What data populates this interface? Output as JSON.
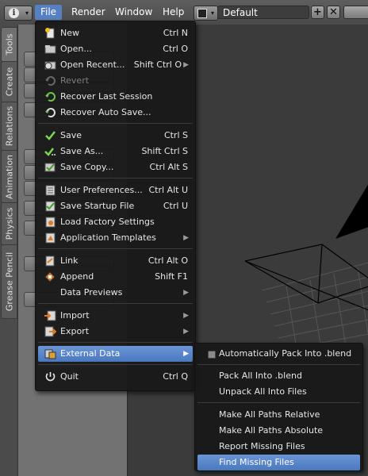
{
  "header": {
    "menus": [
      "File",
      "Render",
      "Window",
      "Help"
    ],
    "layout_name": "Default",
    "add_symbol": "+",
    "remove_symbol": "✕"
  },
  "toolshelf": {
    "tabs": [
      "Tools",
      "Create",
      "Relations",
      "Animation",
      "Physics",
      "Grease Pencil"
    ]
  },
  "file_menu": {
    "items": [
      {
        "label": "New",
        "shortcut": "Ctrl N",
        "icon": "new-file-icon"
      },
      {
        "label": "Open...",
        "shortcut": "Ctrl O",
        "icon": "folder-icon"
      },
      {
        "label": "Open Recent...",
        "shortcut": "Shift Ctrl O",
        "icon": "open-recent-icon",
        "submenu": true
      },
      {
        "label": "Revert",
        "shortcut": "",
        "icon": "revert-icon",
        "disabled": true
      },
      {
        "label": "Recover Last Session",
        "shortcut": "",
        "icon": "recover-icon"
      },
      {
        "label": "Recover Auto Save...",
        "shortcut": "",
        "icon": "recover-autosave-icon"
      },
      {
        "label": "Save",
        "shortcut": "Ctrl S",
        "icon": "checkmark-icon"
      },
      {
        "label": "Save As...",
        "shortcut": "Shift Ctrl S",
        "icon": "save-as-icon"
      },
      {
        "label": "Save Copy...",
        "shortcut": "Ctrl Alt S",
        "icon": "save-copy-icon"
      },
      {
        "label": "User Preferences...",
        "shortcut": "Ctrl Alt U",
        "icon": "preferences-icon"
      },
      {
        "label": "Save Startup File",
        "shortcut": "Ctrl U",
        "icon": "save-startup-icon"
      },
      {
        "label": "Load Factory Settings",
        "shortcut": "",
        "icon": "factory-settings-icon"
      },
      {
        "label": "Application Templates",
        "shortcut": "",
        "icon": "templates-icon",
        "submenu": true
      },
      {
        "label": "Link",
        "shortcut": "Ctrl Alt O",
        "icon": "link-icon"
      },
      {
        "label": "Append",
        "shortcut": "Shift F1",
        "icon": "append-icon"
      },
      {
        "label": "Data Previews",
        "shortcut": "",
        "icon": "",
        "submenu": true
      },
      {
        "label": "Import",
        "shortcut": "",
        "icon": "import-icon",
        "submenu": true
      },
      {
        "label": "Export",
        "shortcut": "",
        "icon": "export-icon",
        "submenu": true
      },
      {
        "label": "External Data",
        "shortcut": "",
        "icon": "external-data-icon",
        "submenu": true,
        "highlighted": true
      },
      {
        "label": "Quit",
        "shortcut": "Ctrl Q",
        "icon": "power-icon"
      }
    ]
  },
  "external_data_menu": {
    "items": [
      {
        "label": "Automatically Pack Into .blend",
        "checkbox": true,
        "checked": false
      },
      {
        "label": "Pack All Into .blend"
      },
      {
        "label": "Unpack All Into Files"
      },
      {
        "label": "Make All Paths Relative"
      },
      {
        "label": "Make All Paths Absolute"
      },
      {
        "label": "Report Missing Files"
      },
      {
        "label": "Find Missing Files",
        "highlighted": true
      }
    ]
  },
  "colors": {
    "highlight": "#5680c2",
    "menu_bg": "#181818",
    "viewport_bg": "#3b3b3b"
  }
}
